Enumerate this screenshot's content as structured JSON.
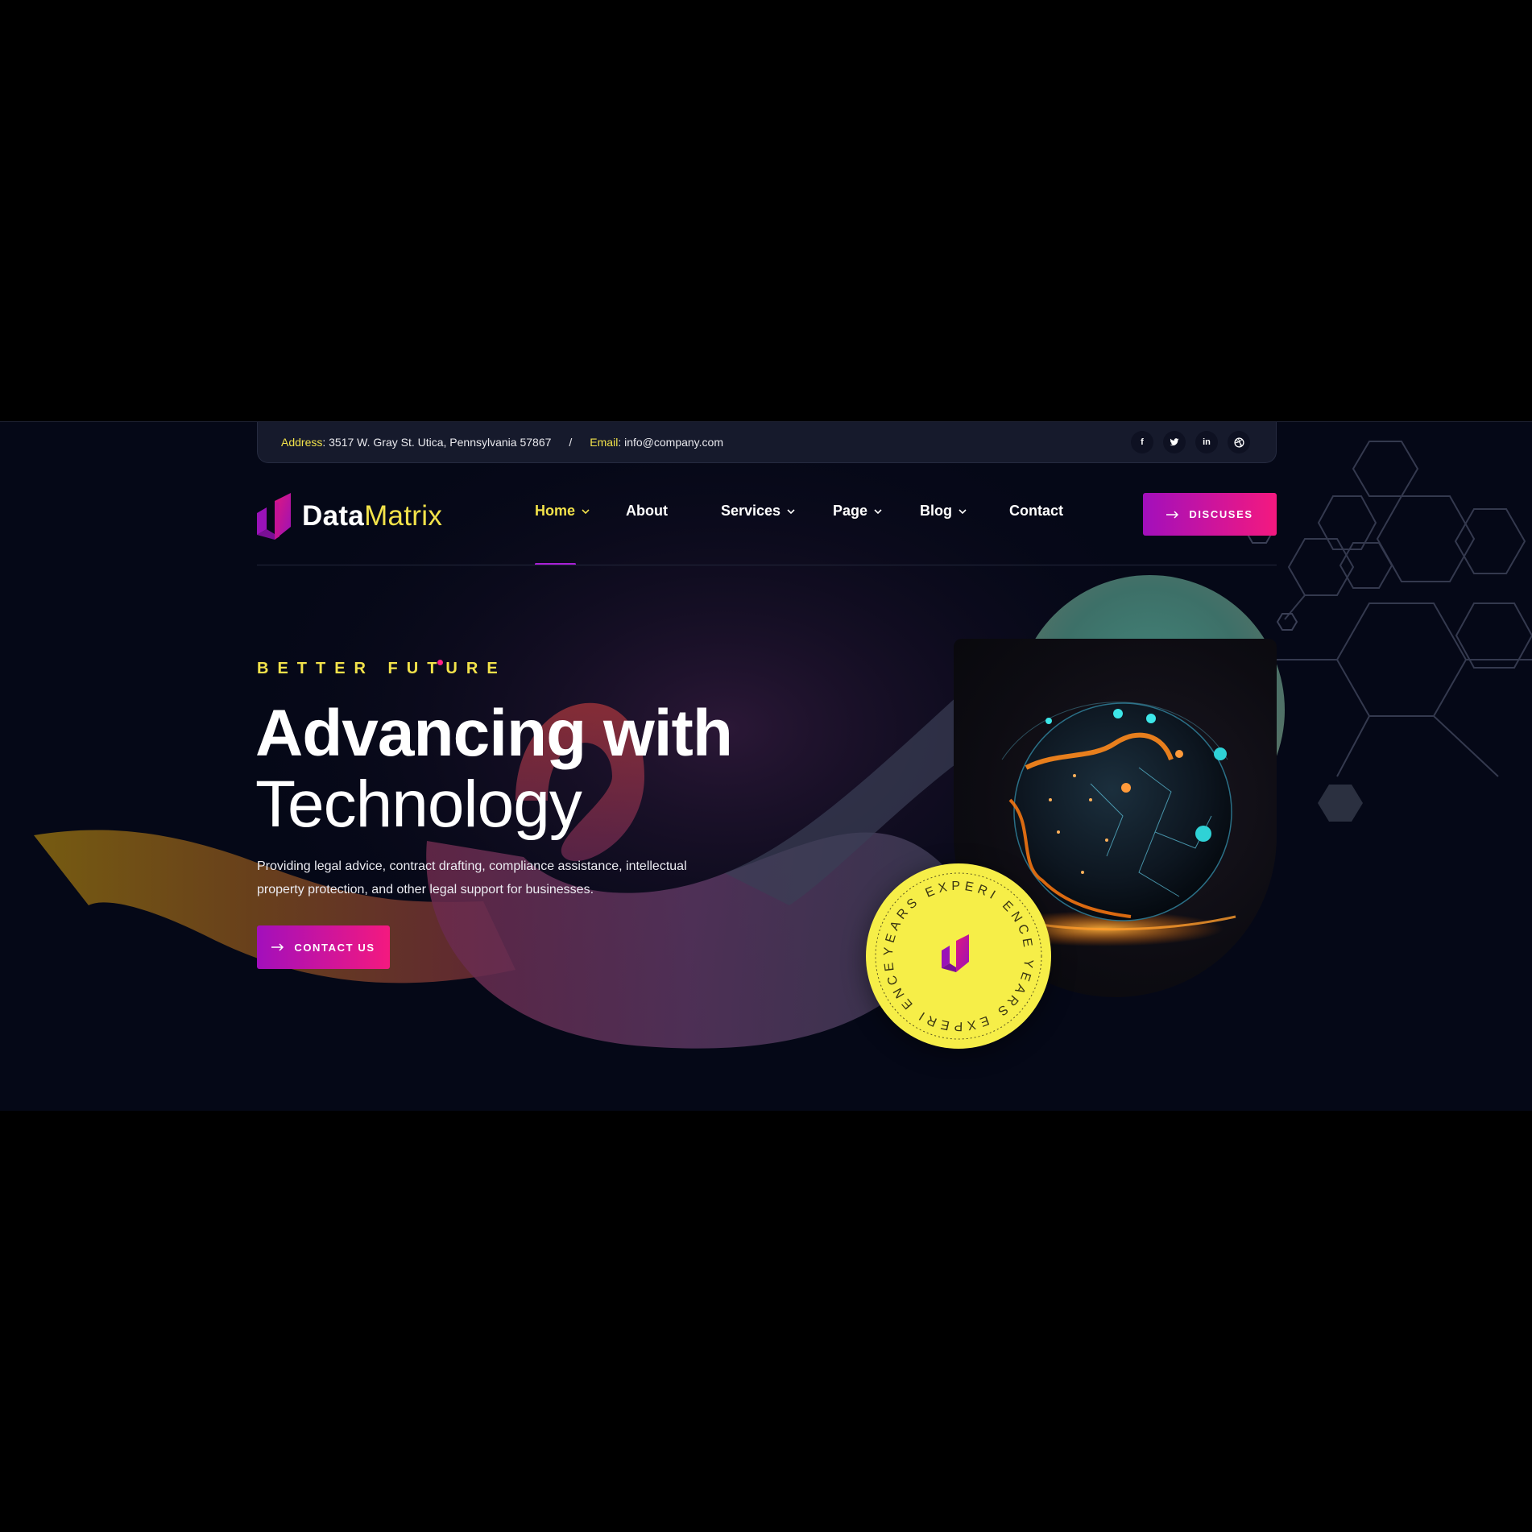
{
  "topbar": {
    "address_label": "Address",
    "address_value": ": 3517 W. Gray St. Utica, Pennsylvania 57867",
    "separator": "/",
    "email_label": "Email",
    "email_value": ": info@company.com",
    "socials": [
      {
        "icon": "facebook-icon",
        "glyph": "f"
      },
      {
        "icon": "twitter-icon",
        "glyph": "🐦"
      },
      {
        "icon": "linkedin-icon",
        "glyph": "in"
      },
      {
        "icon": "dribbble-icon",
        "glyph": "◎"
      }
    ]
  },
  "brand": {
    "name_part1": "Data",
    "name_part2": "Matrix"
  },
  "nav": {
    "items": [
      {
        "label": "Home",
        "active": true,
        "dropdown": true
      },
      {
        "label": "About",
        "active": false,
        "dropdown": false
      },
      {
        "label": "Services",
        "active": false,
        "dropdown": true
      },
      {
        "label": "Page",
        "active": false,
        "dropdown": true
      },
      {
        "label": "Blog",
        "active": false,
        "dropdown": true
      },
      {
        "label": "Contact",
        "active": false,
        "dropdown": false
      }
    ],
    "cta_label": "DISCUSES",
    "cta_icon": "arrow-right-icon"
  },
  "hero": {
    "eyebrow": "BETTER FUTURE",
    "title_line1": "Advancing with",
    "title_line2": "Technology",
    "description": "Providing legal advice, contract drafting, compliance assistance, intellectual property protection, and other legal support for businesses.",
    "button_label": "CONTACT US",
    "button_icon": "arrow-right-icon"
  },
  "badge": {
    "ring_text": "YEARS EXPERI ENCE YEARS EXPERI ENCE"
  },
  "colors": {
    "accent_yellow": "#f2e24a",
    "gradient_start": "#a20fbc",
    "gradient_end": "#f4197f",
    "background": "#050817"
  }
}
